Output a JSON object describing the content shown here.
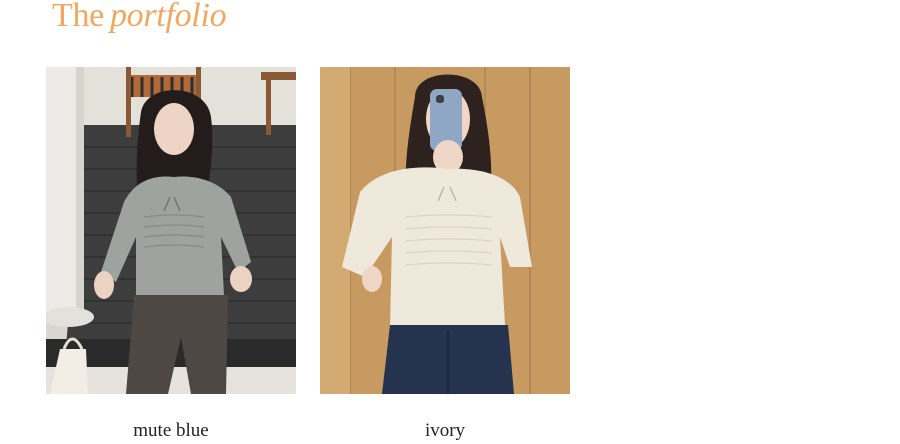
{
  "header": {
    "title_prefix": "The",
    "title_word": "portfolio",
    "accent_color": "#f0a860"
  },
  "products": [
    {
      "color_name": "mute blue",
      "image_icon": "photo-model-blouse-grey-icon",
      "blouse_color": "#9ea3a0"
    },
    {
      "color_name": "ivory",
      "image_icon": "photo-model-blouse-ivory-icon",
      "blouse_color": "#efe9dc"
    }
  ]
}
